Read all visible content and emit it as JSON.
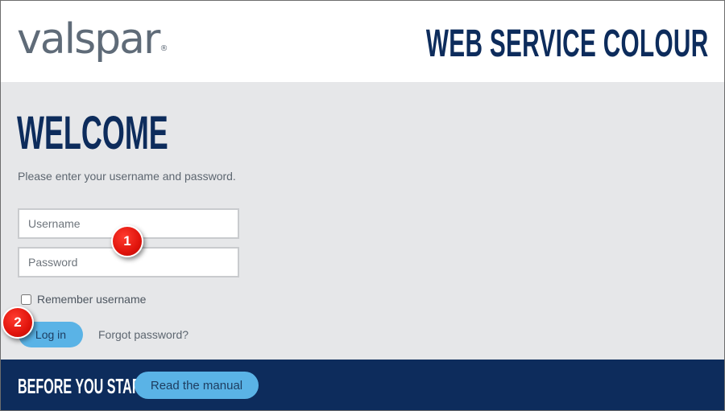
{
  "header": {
    "logo_text": "valspar",
    "logo_mark": "®",
    "app_title": "WEB SERVICE COLOUR"
  },
  "login": {
    "heading": "WELCOME",
    "instructions": "Please enter your username and password.",
    "username": {
      "placeholder": "Username",
      "value": ""
    },
    "password": {
      "placeholder": "Password",
      "value": ""
    },
    "remember_label": "Remember username",
    "remember_checked": false,
    "login_label": "Log in",
    "forgot_label": "Forgot password?"
  },
  "footer": {
    "label": "BEFORE YOU START",
    "manual_label": "Read the manual"
  },
  "annotations": {
    "step1": "1",
    "step2": "2"
  },
  "colors": {
    "brand_navy": "#0d2c5c",
    "button_blue": "#5ab3e6",
    "panel_gray": "#e6e7e9",
    "marker_red": "#e0140c"
  }
}
